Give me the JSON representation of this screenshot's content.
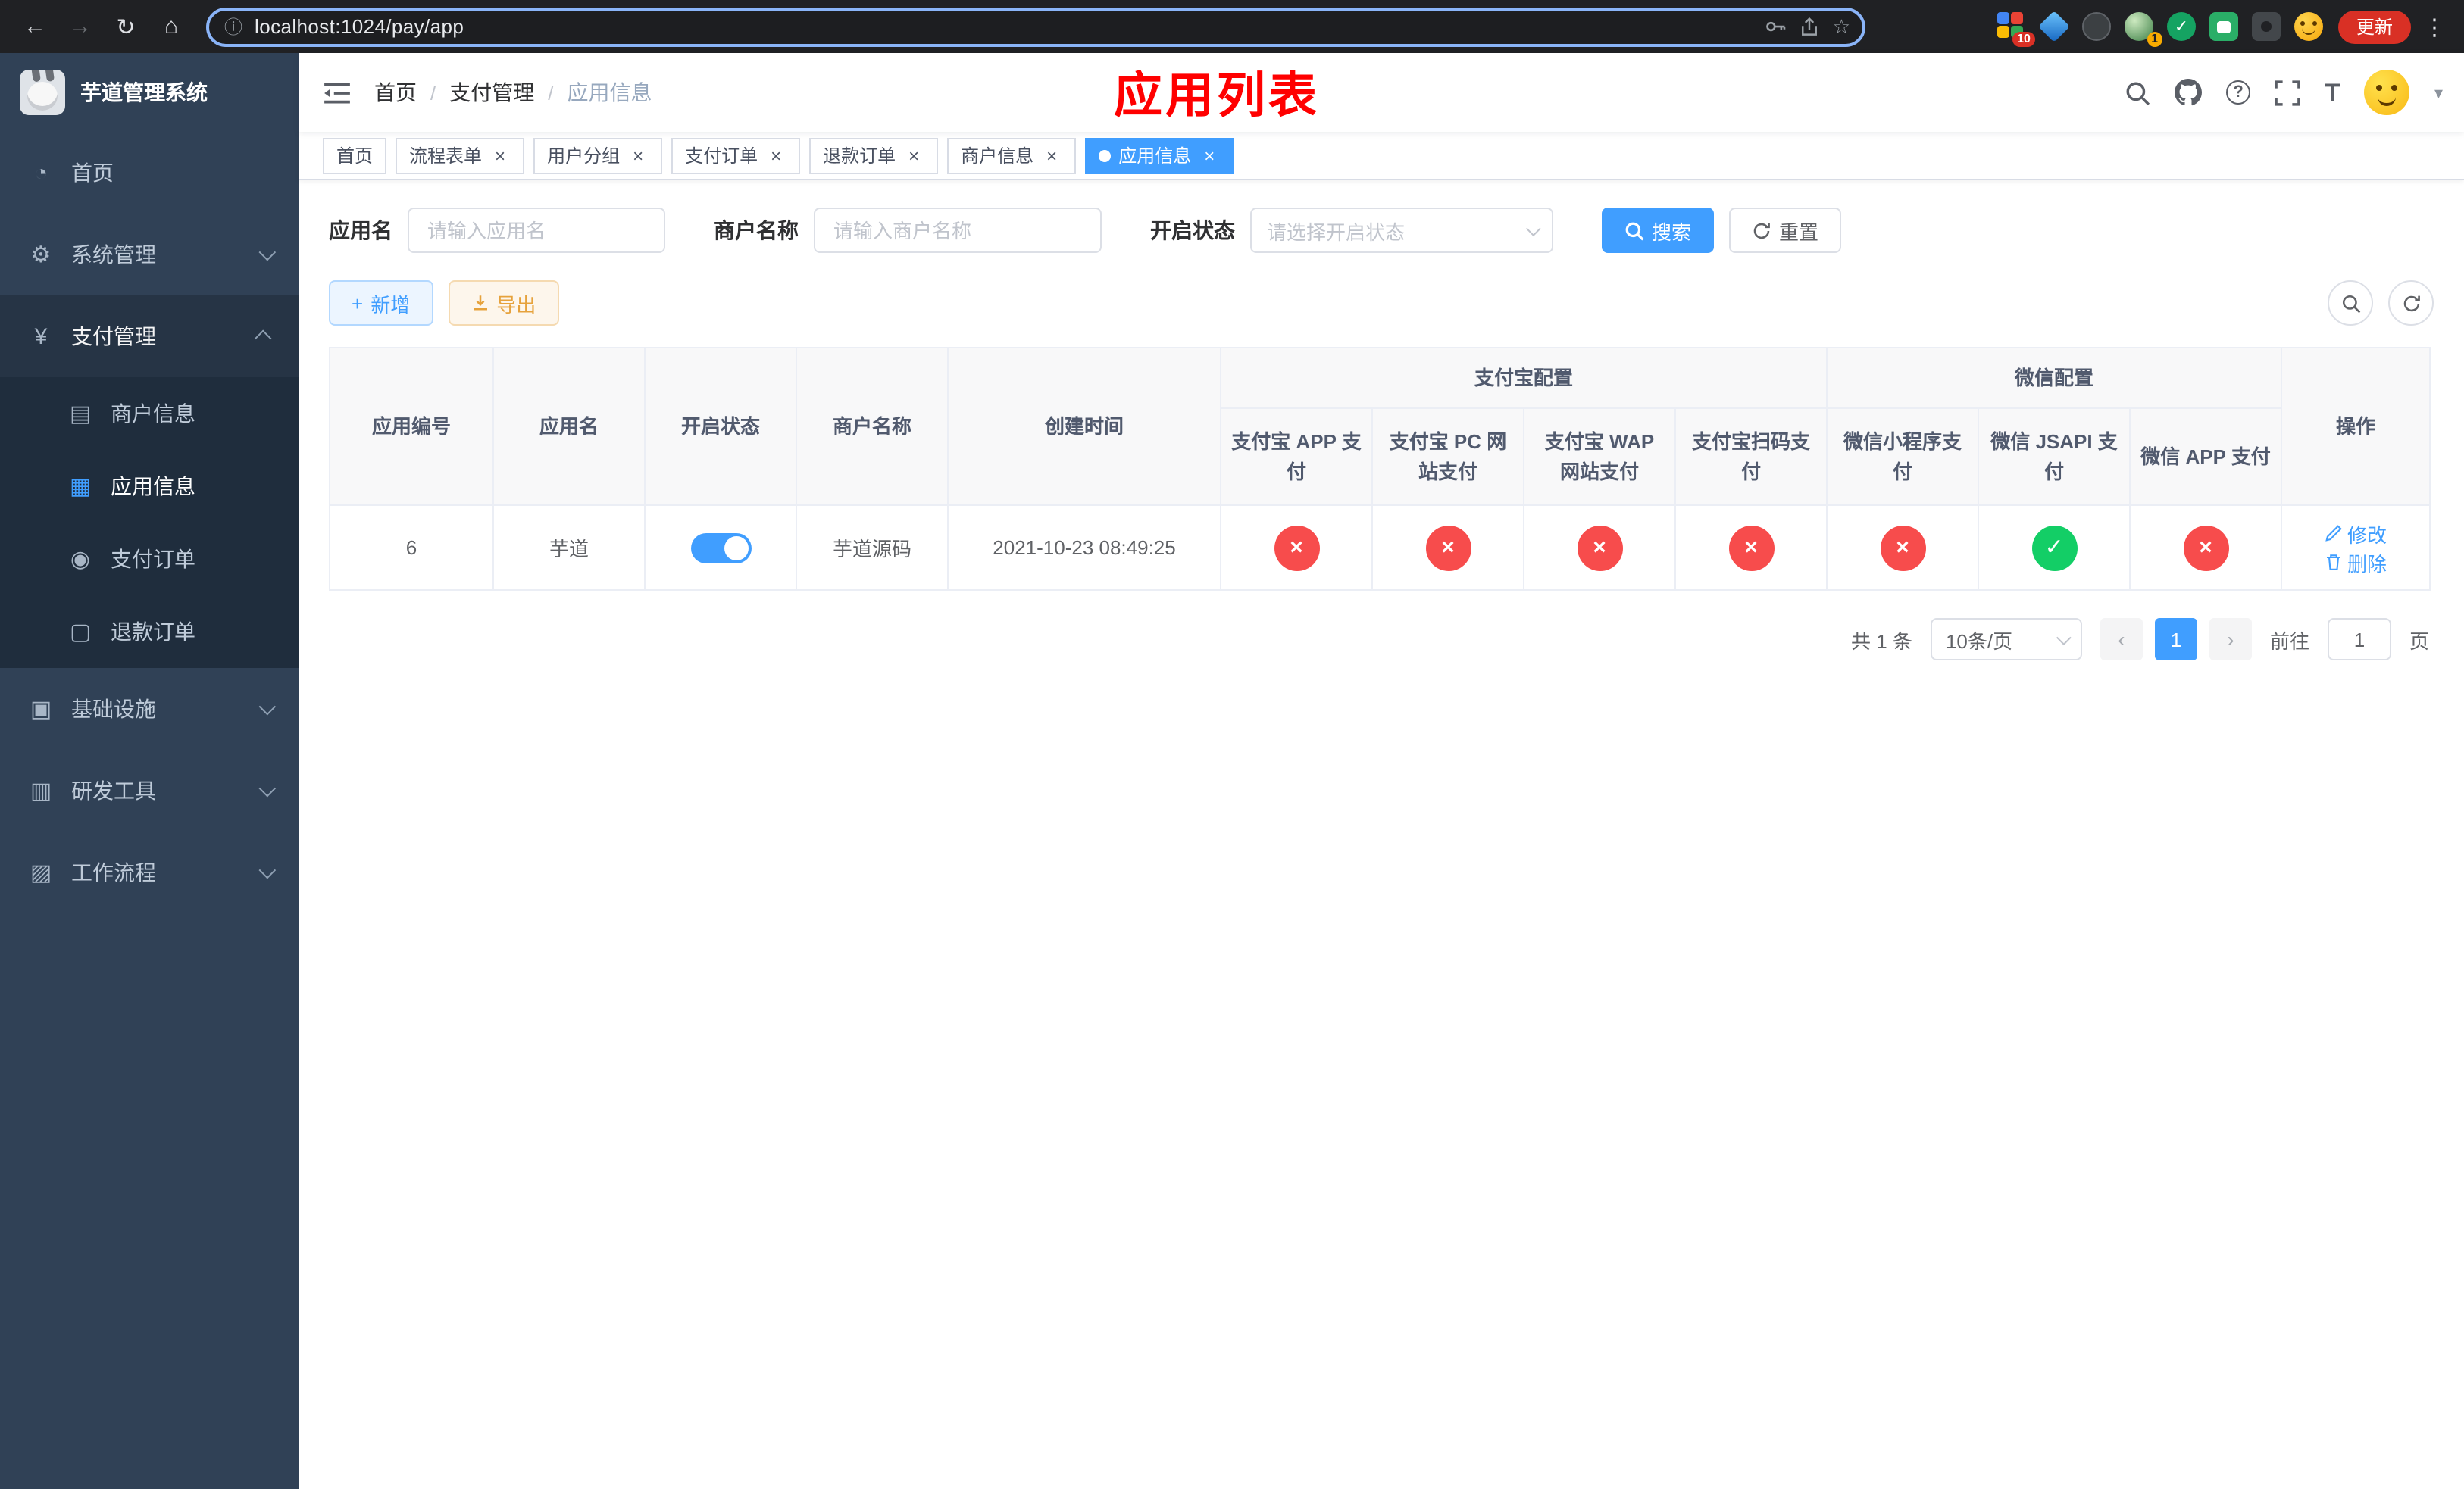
{
  "browser": {
    "url": "localhost:1024/pay/app",
    "update_label": "更新",
    "ext_badge_count": "10",
    "profile_badge_count": "1"
  },
  "icons": {
    "back": "←",
    "forward": "→",
    "reload": "↻",
    "home": "⌂",
    "info": "ⓘ",
    "star": "☆",
    "kebab": "⋮",
    "caret_down": "▾",
    "close": "×",
    "check": "✓",
    "cross": "×",
    "prev": "‹",
    "next": "›",
    "separator": "/",
    "plus": "+",
    "dashboard": "◔",
    "gear": "⚙",
    "yen": "¥",
    "merchant": "▤",
    "app": "▦",
    "order": "◉",
    "refund": "▢",
    "infra": "▣",
    "devtools": "▥",
    "workflow": "▨",
    "question": "?",
    "font_size": "T"
  },
  "sidebar": {
    "app_title": "芋道管理系统",
    "menu": [
      {
        "label": "首页"
      },
      {
        "label": "系统管理"
      },
      {
        "label": "支付管理"
      },
      {
        "label": "基础设施"
      },
      {
        "label": "研发工具"
      },
      {
        "label": "工作流程"
      }
    ],
    "submenu": [
      {
        "label": "商户信息"
      },
      {
        "label": "应用信息"
      },
      {
        "label": "支付订单"
      },
      {
        "label": "退款订单"
      }
    ]
  },
  "header": {
    "breadcrumb": [
      "首页",
      "支付管理",
      "应用信息"
    ],
    "annotation": "应用列表"
  },
  "tabs": [
    {
      "label": "首页"
    },
    {
      "label": "流程表单"
    },
    {
      "label": "用户分组"
    },
    {
      "label": "支付订单"
    },
    {
      "label": "退款订单"
    },
    {
      "label": "商户信息"
    },
    {
      "label": "应用信息"
    }
  ],
  "filters": {
    "app_name_label": "应用名",
    "app_name_placeholder": "请输入应用名",
    "merchant_label": "商户名称",
    "merchant_placeholder": "请输入商户名称",
    "status_label": "开启状态",
    "status_placeholder": "请选择开启状态",
    "search_label": "搜索",
    "reset_label": "重置"
  },
  "toolbar": {
    "add_label": "新增",
    "export_label": "导出"
  },
  "table": {
    "group_alipay": "支付宝配置",
    "group_wechat": "微信配置",
    "columns": {
      "app_id": "应用编号",
      "app_name": "应用名",
      "status": "开启状态",
      "merchant": "商户名称",
      "created": "创建时间",
      "alipay_app": "支付宝 APP 支付",
      "alipay_pc": "支付宝 PC 网站支付",
      "alipay_wap": "支付宝 WAP 网站支付",
      "alipay_qr": "支付宝扫码支付",
      "wx_mini": "微信小程序支付",
      "wx_jsapi": "微信 JSAPI 支付",
      "wx_app": "微信 APP 支付",
      "actions": "操作"
    },
    "rows": [
      {
        "app_id": "6",
        "app_name": "芋道",
        "status": "on",
        "merchant": "芋道源码",
        "created": "2021-10-23 08:49:25",
        "alipay_app": "disabled",
        "alipay_pc": "disabled",
        "alipay_wap": "disabled",
        "alipay_qr": "disabled",
        "wx_mini": "disabled",
        "wx_jsapi": "enabled",
        "wx_app": "disabled",
        "edit_label": "修改",
        "delete_label": "删除"
      }
    ]
  },
  "pagination": {
    "total_label": "共 1 条",
    "page_size_label": "10条/页",
    "current_page": "1",
    "goto_label": "前往",
    "goto_value": "1",
    "unit_label": "页"
  }
}
